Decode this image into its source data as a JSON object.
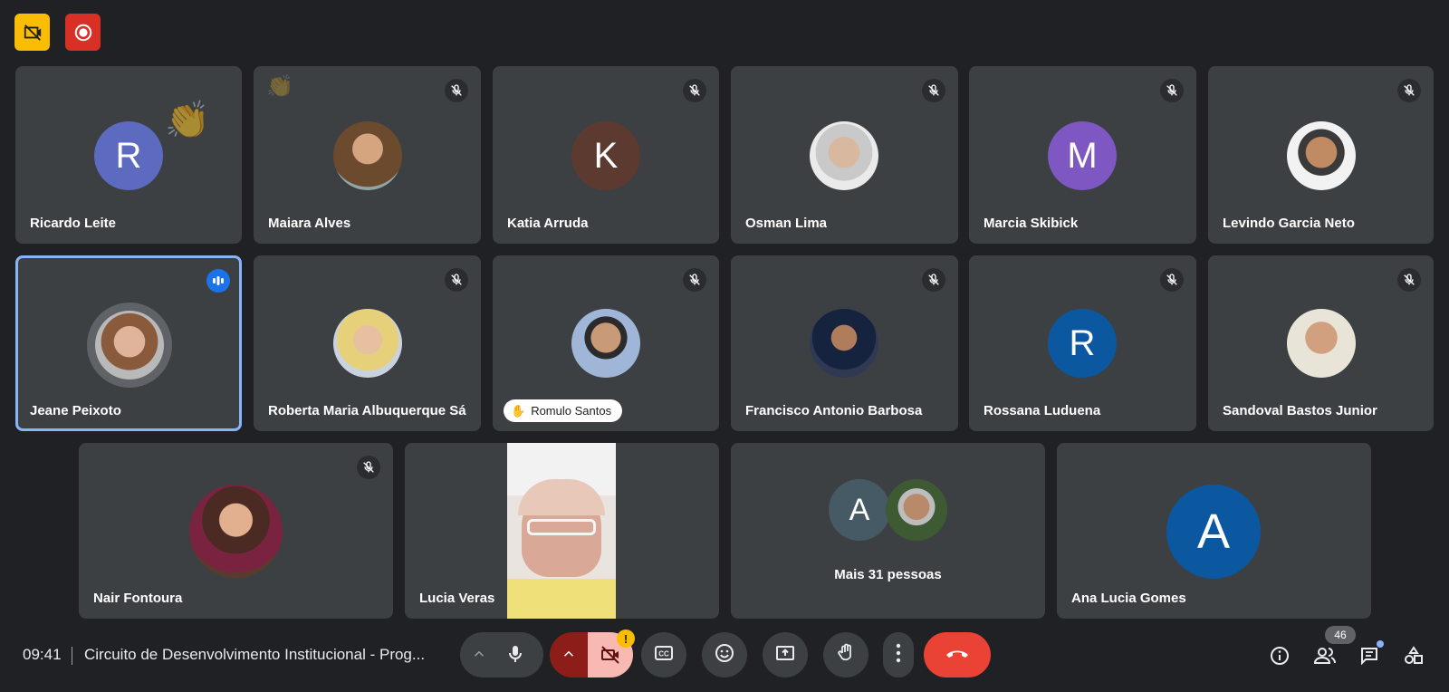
{
  "colors": {
    "background": "#202124",
    "tile": "#3c4043",
    "accent": "#8ab4f8",
    "end_call": "#ea4335",
    "warning": "#fbbc04"
  },
  "top_badges": [
    {
      "icon": "no-video-badge-icon"
    },
    {
      "icon": "recording-icon"
    }
  ],
  "participants": [
    {
      "name": "Ricardo Leite",
      "initial": "R",
      "avatar_color": "#5c6bc0",
      "muted": false,
      "reaction": "clapping-hands-icon"
    },
    {
      "name": "Maiara Alves",
      "photo": true,
      "muted": true
    },
    {
      "name": "Katia Arruda",
      "initial": "K",
      "avatar_color": "#5d3a30",
      "muted": true
    },
    {
      "name": "Osman Lima",
      "photo": true,
      "muted": true
    },
    {
      "name": "Marcia Skibick",
      "initial": "M",
      "avatar_color": "#7e57c2",
      "muted": true
    },
    {
      "name": "Levindo Garcia Neto",
      "photo": true,
      "muted": true
    },
    {
      "name": "Jeane Peixoto",
      "photo": true,
      "speaking": true,
      "active": true
    },
    {
      "name": "Roberta Maria Albuquerque Sá",
      "photo": true,
      "muted": true
    },
    {
      "name": "Romulo Santos",
      "photo": true,
      "muted": true,
      "hand_raised": true
    },
    {
      "name": "Francisco Antonio Barbosa",
      "photo": true,
      "muted": true
    },
    {
      "name": "Rossana Luduena",
      "initial": "R",
      "avatar_color": "#0b57a0",
      "muted": true
    },
    {
      "name": "Sandoval Bastos Junior",
      "photo": true,
      "muted": true
    },
    {
      "name": "Nair Fontoura",
      "photo": true,
      "muted": true
    },
    {
      "name": "Lucia Veras",
      "video": true
    },
    {
      "others_label": "Mais 31 pessoas",
      "initial": "A",
      "avatar_color": "#455a64"
    },
    {
      "name": "Ana Lucia Gomes",
      "initial": "A",
      "avatar_color": "#0b57a0"
    }
  ],
  "bottom_bar": {
    "time": "09:41",
    "meeting_title": "Circuito de Desenvolvimento Institucional - Prog...",
    "participant_count": "46",
    "controls": [
      "more-audio-options-icon",
      "microphone-icon",
      "more-video-options-icon",
      "camera-off-icon",
      "captions-icon",
      "emoji-icon",
      "present-screen-icon",
      "raise-hand-icon",
      "more-options-icon",
      "end-call-icon"
    ],
    "right_controls": [
      "meeting-info-icon",
      "people-icon",
      "chat-icon",
      "activities-icon"
    ]
  }
}
